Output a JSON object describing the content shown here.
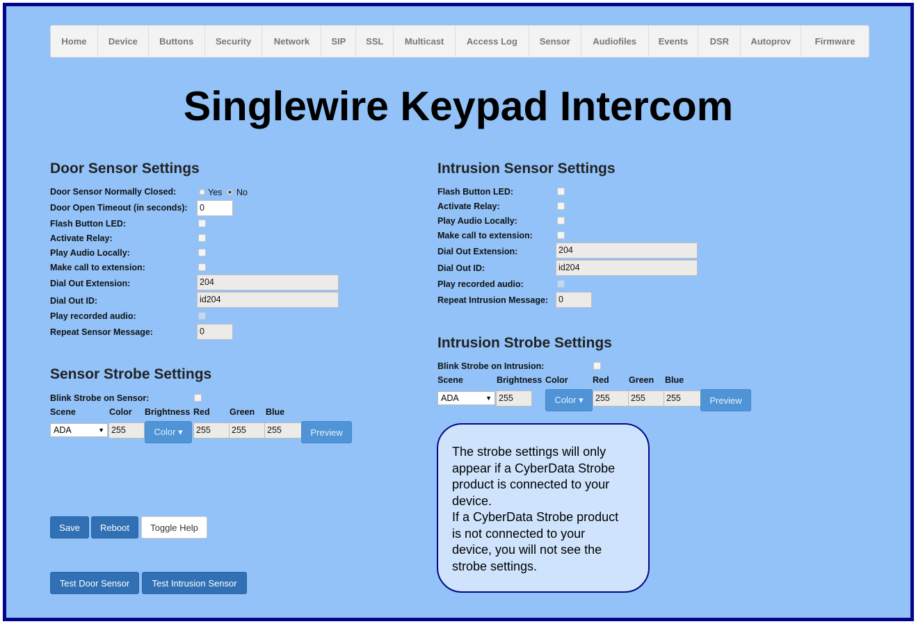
{
  "nav": [
    "Home",
    "Device",
    "Buttons",
    "Security",
    "Network",
    "SIP",
    "SSL",
    "Multicast",
    "Access Log",
    "Sensor",
    "Audiofiles",
    "Events",
    "DSR",
    "Autoprov",
    "Firmware"
  ],
  "page_title": "Singlewire Keypad Intercom",
  "door": {
    "title": "Door Sensor Settings",
    "normally_closed_label": "Door Sensor Normally Closed:",
    "yes_label": "Yes",
    "no_label": "No",
    "normally_closed_value": "No",
    "timeout_label": "Door Open Timeout (in seconds):",
    "timeout_value": "0",
    "flash_label": "Flash Button LED:",
    "relay_label": "Activate Relay:",
    "play_local_label": "Play Audio Locally:",
    "make_call_label": "Make call to extension:",
    "dial_ext_label": "Dial Out Extension:",
    "dial_ext_value": "204",
    "dial_id_label": "Dial Out ID:",
    "dial_id_value": "id204",
    "play_recorded_label": "Play recorded audio:",
    "repeat_label": "Repeat Sensor Message:",
    "repeat_value": "0"
  },
  "sensor_strobe": {
    "title": "Sensor Strobe Settings",
    "blink_label": "Blink Strobe on Sensor:",
    "headers": [
      "Scene",
      "Color",
      "Brightness",
      "Red",
      "Green",
      "Blue"
    ],
    "scene": "ADA",
    "brightness": "255",
    "color_button": "Color ▾",
    "red": "255",
    "green": "255",
    "blue": "255",
    "preview": "Preview"
  },
  "intrusion": {
    "title": "Intrusion Sensor Settings",
    "flash_label": "Flash Button LED:",
    "relay_label": "Activate Relay:",
    "play_local_label": "Play Audio Locally:",
    "make_call_label": "Make call to extension:",
    "dial_ext_label": "Dial Out Extension:",
    "dial_ext_value": "204",
    "dial_id_label": "Dial Out ID:",
    "dial_id_value": "id204",
    "play_recorded_label": "Play recorded audio:",
    "repeat_label": "Repeat Intrusion Message:",
    "repeat_value": "0"
  },
  "intrusion_strobe": {
    "title": "Intrusion Strobe Settings",
    "blink_label": "Blink Strobe on Intrusion:",
    "headers": [
      "Scene",
      "Brightness",
      "Color",
      "Red",
      "Green",
      "Blue"
    ],
    "scene": "ADA",
    "brightness": "255",
    "color_button": "Color ▾",
    "red": "255",
    "green": "255",
    "blue": "255",
    "preview": "Preview"
  },
  "buttons": {
    "save": "Save",
    "reboot": "Reboot",
    "toggle_help": "Toggle Help",
    "test_door": "Test Door Sensor",
    "test_intrusion": "Test Intrusion Sensor"
  },
  "help_text": [
    "The strobe settings will only",
    "appear if a CyberData Strobe",
    "product is connected to your",
    "device.",
    "If a CyberData Strobe product",
    "is not connected to your",
    "device, you will not see the",
    "strobe settings."
  ]
}
